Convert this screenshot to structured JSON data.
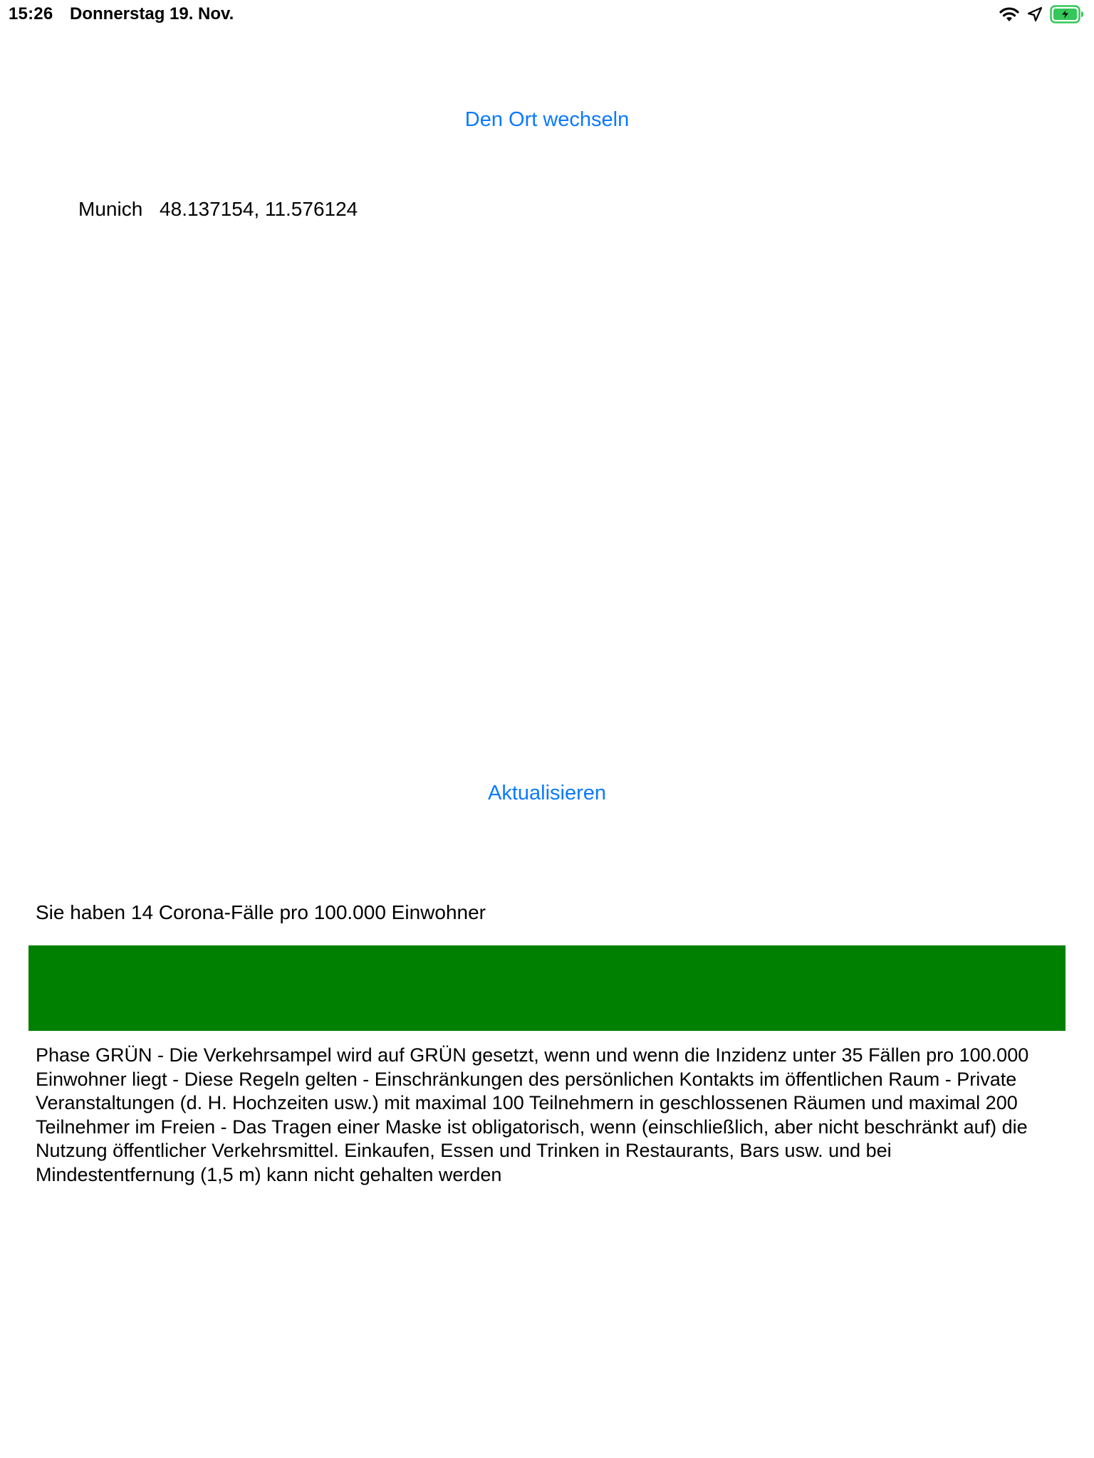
{
  "status_bar": {
    "time": "15:26",
    "date": "Donnerstag 19. Nov.",
    "icons": [
      "wifi-icon",
      "location-arrow-icon",
      "battery-charging-icon"
    ]
  },
  "location": {
    "change_button_label": "Den Ort wechseln",
    "city": "Munich",
    "coordinates": "48.137154, 11.576124"
  },
  "refresh_button_label": "Aktualisieren",
  "incidence": {
    "text": "Sie haben 14 Corona-Fälle pro 100.000 Einwohner",
    "status_color": "#008000"
  },
  "phase": {
    "description": "Phase GRÜN - Die Verkehrsampel wird auf GRÜN gesetzt, wenn und wenn die Inzidenz unter 35 Fällen pro 100.000 Einwohner liegt - Diese Regeln gelten - Einschränkungen des persönlichen Kontakts im öffentlichen Raum - Private Veranstaltungen (d. H. Hochzeiten usw.) mit maximal 100 Teilnehmern in geschlossenen Räumen und maximal 200 Teilnehmer im Freien - Das Tragen einer Maske ist obligatorisch, wenn (einschließlich, aber nicht beschränkt auf) die Nutzung öffentlicher Verkehrsmittel. Einkaufen, Essen und Trinken in Restaurants, Bars usw. und bei Mindestentfernung (1,5 m) kann nicht gehalten werden"
  },
  "colors": {
    "accent": "#0a7aff",
    "battery_green": "#34c759"
  }
}
